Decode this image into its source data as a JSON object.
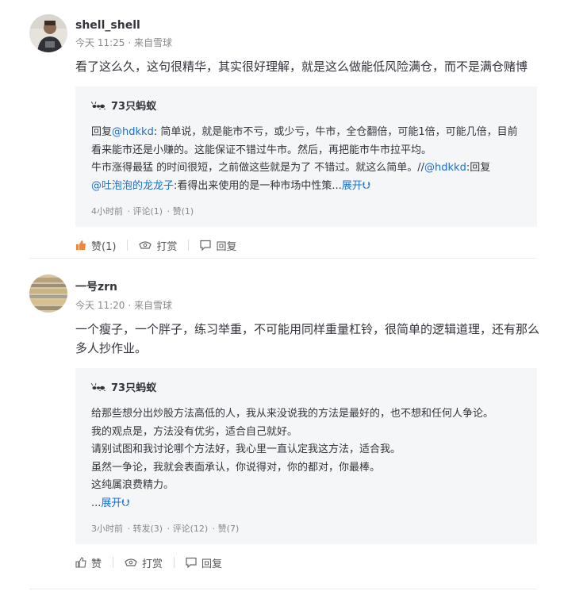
{
  "posts": [
    {
      "username": "shell_shell",
      "time": "今天 11:25",
      "source": "· 来自雪球",
      "content": "看了这么久，这句很精华，其实很好理解，就是这么做能低风险满仓，而不是满仓赌博",
      "quote": {
        "author": "73只蚂蚁",
        "lines": {
          "l1a": "回复",
          "l1link": "@hdkkd",
          "l1b": ": 简单说，就是能市不亏，或少亏，牛市，全仓翻倍，可能1倍，可能几倍，目前看来能市还是小赚的。这能保证不错过牛市。然后，再把能市牛市拉平均。",
          "l2": "牛市涨得最猛 的时间很短，之前做这些就是为了 不错过。就这么简单。//",
          "l2link": "@hdkkd",
          "l2b": ":回复",
          "l3link": "@吐泡泡的龙龙子",
          "l3b": ":看得出来使用的是一种市场中性策...",
          "more": "展开"
        },
        "time": "4小时前",
        "comments": "· 评论(1)",
        "likes": "· 赞(1)"
      },
      "actions": {
        "like": "赞(1)",
        "reward": "打赏",
        "reply": "回复"
      }
    },
    {
      "username": "一号zrn",
      "time": "今天 11:20",
      "source": "· 来自雪球",
      "content": "一个瘦子，一个胖子，练习举重，不可能用同样重量杠铃，很简单的逻辑道理，还有那么多人抄作业。",
      "quote": {
        "author": "73只蚂蚁",
        "p1": "给那些想分出炒股方法高低的人，我从来没说我的方法是最好的，也不想和任何人争论。",
        "p2": "我的观点是，方法没有优劣，适合自己就好。",
        "p3": "请别试图和我讨论哪个方法好，我心里一直认定我这方法，适合我。",
        "p4": "虽然一争论，我就会表面承认，你说得对，你的都对，你最棒。",
        "p5": "这纯属浪费精力。",
        "ellipsis": "...",
        "more": "展开",
        "time": "3小时前",
        "reposts": "· 转发(3)",
        "comments": "· 评论(12)",
        "likes": "· 赞(7)"
      },
      "actions": {
        "like": "赞",
        "reward": "打赏",
        "reply": "回复"
      }
    }
  ]
}
